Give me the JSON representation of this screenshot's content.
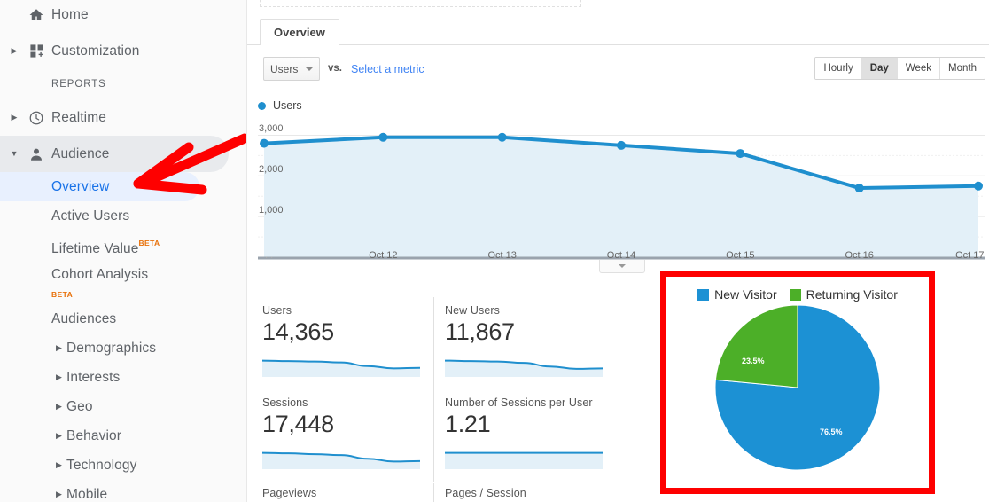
{
  "sidebar": {
    "top_items": [
      {
        "label": "Home",
        "icon": "home-icon",
        "has_twisty": false
      },
      {
        "label": "Customization",
        "icon": "customization-grid-icon",
        "has_twisty": true
      }
    ],
    "section_header": "REPORTS",
    "report_items": [
      {
        "label": "Realtime",
        "icon": "clock-icon",
        "has_twisty": true,
        "expanded": false
      },
      {
        "label": "Audience",
        "icon": "person-icon",
        "has_twisty": true,
        "expanded": true
      }
    ],
    "audience_sub_items": [
      {
        "label": "Overview",
        "active": true,
        "expandable": false,
        "badge": ""
      },
      {
        "label": "Active Users",
        "active": false,
        "expandable": false,
        "badge": ""
      },
      {
        "label": "Lifetime Value",
        "active": false,
        "expandable": false,
        "badge": "BETA",
        "badge_position": "inline"
      },
      {
        "label": "Cohort Analysis",
        "active": false,
        "expandable": false,
        "badge": "BETA",
        "badge_position": "below"
      },
      {
        "label": "Audiences",
        "active": false,
        "expandable": false,
        "badge": ""
      },
      {
        "label": "Demographics",
        "active": false,
        "expandable": true,
        "badge": ""
      },
      {
        "label": "Interests",
        "active": false,
        "expandable": true,
        "badge": ""
      },
      {
        "label": "Geo",
        "active": false,
        "expandable": true,
        "badge": ""
      },
      {
        "label": "Behavior",
        "active": false,
        "expandable": true,
        "badge": ""
      },
      {
        "label": "Technology",
        "active": false,
        "expandable": true,
        "badge": ""
      },
      {
        "label": "Mobile",
        "active": false,
        "expandable": true,
        "badge": ""
      }
    ]
  },
  "annotation": {
    "arrow_color": "#fe0000",
    "arrow_target": "Overview",
    "highlight_box_color": "#fe0000",
    "highlight_target": "new-vs-returning-pie-chart"
  },
  "tabs": [
    {
      "label": "Overview",
      "active": true
    }
  ],
  "metric_selector": {
    "selected_metric": "Users",
    "vs_label": "vs.",
    "compare_link": "Select a metric"
  },
  "period_toggle": {
    "options": [
      "Hourly",
      "Day",
      "Week",
      "Month"
    ],
    "selected": "Day"
  },
  "chart_legend": {
    "series_name": "Users",
    "color": "#1f8fce"
  },
  "chart_collapse": {
    "icon": "chevron-down-icon"
  },
  "metric_cards": [
    {
      "title": "Users",
      "value": "14,365"
    },
    {
      "title": "New Users",
      "value": "11,867"
    },
    {
      "title": "Sessions",
      "value": "17,448"
    },
    {
      "title": "Number of Sessions per User",
      "value": "1.21"
    }
  ],
  "metric_cards_bottom": [
    {
      "title": "Pageviews"
    },
    {
      "title": "Pages / Session"
    }
  ],
  "chart_data": [
    {
      "type": "line",
      "title": "Users",
      "xlabel": "",
      "ylabel": "",
      "x": [
        "...",
        "Oct 12",
        "Oct 13",
        "Oct 14",
        "Oct 15",
        "Oct 16",
        "Oct 17"
      ],
      "categories": [
        "...",
        "Oct 12",
        "Oct 13",
        "Oct 14",
        "Oct 15",
        "Oct 16",
        "Oct 17"
      ],
      "series": [
        {
          "name": "Users",
          "values": [
            2800,
            2950,
            2950,
            2750,
            2550,
            1700,
            1750
          ],
          "color": "#1f8fce"
        }
      ],
      "ylim": [
        0,
        3250
      ],
      "yticks": [
        1000,
        2000,
        3000
      ],
      "ytick_labels": [
        "1,000",
        "2,000",
        "3,000"
      ],
      "grid": true,
      "area_fill": "#e3f0f8",
      "legend_position": "top-left"
    },
    {
      "type": "pie",
      "title": "New vs Returning",
      "labels": [
        "New Visitor",
        "Returning Visitor"
      ],
      "values": [
        76.5,
        23.5
      ],
      "value_labels": [
        "76.5%",
        "23.5%"
      ],
      "colors": [
        "#1c91d4",
        "#4caf28"
      ],
      "legend_position": "top"
    },
    {
      "type": "line",
      "title": "Users sparkline",
      "values": [
        100,
        99,
        98,
        96,
        88,
        83,
        84
      ],
      "color": "#1f8fce"
    },
    {
      "type": "line",
      "title": "New Users sparkline",
      "values": [
        100,
        99,
        98,
        95,
        87,
        82,
        83
      ],
      "color": "#1f8fce"
    },
    {
      "type": "line",
      "title": "Sessions sparkline",
      "values": [
        100,
        99,
        97,
        95,
        87,
        81,
        82
      ],
      "color": "#1f8fce"
    },
    {
      "type": "line",
      "title": "Sessions per User sparkline",
      "values": [
        100,
        100,
        100,
        100,
        100,
        100,
        100
      ],
      "color": "#1f8fce"
    }
  ]
}
